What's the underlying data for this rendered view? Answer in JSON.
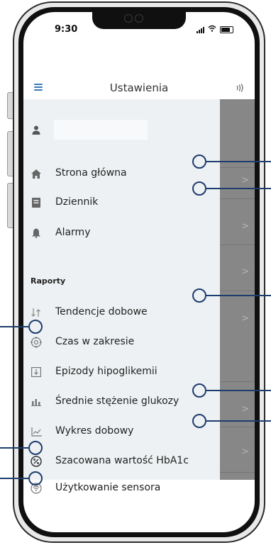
{
  "status": {
    "time": "9:30"
  },
  "header": {
    "title": "Ustawienia"
  },
  "menu": {
    "items_top": [
      {
        "label": "Strona główna",
        "icon": "home-icon"
      },
      {
        "label": "Dziennik",
        "icon": "logbook-icon"
      },
      {
        "label": "Alarmy",
        "icon": "bell-icon"
      }
    ],
    "section_title": "Raporty",
    "reports": [
      {
        "label": "Tendencje dobowe",
        "icon": "daily-trends-icon"
      },
      {
        "label": "Czas w zakresie",
        "icon": "time-in-range-icon"
      },
      {
        "label": "Epizody hipoglikemii",
        "icon": "low-glucose-events-icon"
      },
      {
        "label": "Średnie stężenie glukozy",
        "icon": "average-glucose-icon"
      },
      {
        "label": "Wykres dobowy",
        "icon": "daily-graph-icon"
      },
      {
        "label": "Szacowana wartość HbA1c",
        "icon": "percent-icon"
      },
      {
        "label": "Użytkowanie sensora",
        "icon": "sensor-usage-icon"
      }
    ]
  },
  "colors": {
    "accent": "#3a79b8",
    "callout": "#1d3d6e",
    "drawer_bg": "#eef1f3",
    "overlay": "#878787"
  }
}
